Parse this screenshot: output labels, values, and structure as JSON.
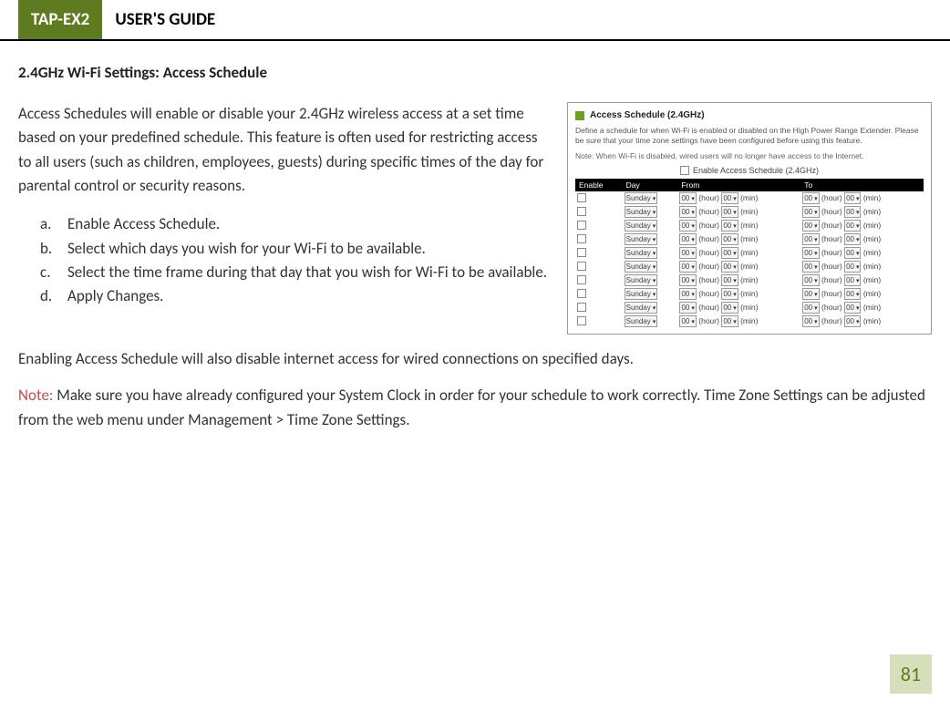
{
  "header": {
    "badge": "TAP-EX2",
    "title": "USER'S GUIDE"
  },
  "section_heading": "2.4GHz Wi-Fi Settings: Access Schedule",
  "intro": "Access Schedules will enable or disable your 2.4GHz wireless access at a set time based on your predefined schedule.  This feature is often used for restricting access to all users (such as children, employees, guests) during specific times of the day for parental control or security reasons.",
  "steps": [
    {
      "marker": "a.",
      "text": "Enable Access Schedule."
    },
    {
      "marker": "b.",
      "text": "Select which days you wish for your Wi-Fi to be available."
    },
    {
      "marker": "c.",
      "text": "Select the time frame during that day that you wish for Wi-Fi to be available."
    },
    {
      "marker": "d.",
      "text": "Apply Changes."
    }
  ],
  "post_para": "Enabling Access Schedule will also disable internet access for wired connections on specified days.",
  "note_label": "Note:",
  "note_text": "  Make sure you have already configured your System Clock in order for your schedule to work correctly.  Time Zone Settings can be adjusted from the web menu under Management > Time Zone Settings.",
  "page_number": "81",
  "shot": {
    "title": "Access Schedule (2.4GHz)",
    "desc": "Define a schedule for when Wi-Fi is enabled or disabled on the High Power Range Extender. Please be sure that your time zone settings have been configured before using this feature.",
    "note": "Note: When Wi-Fi is disabled, wired users will no longer have access to the Internet.",
    "enable_label": "Enable Access Schedule (2.4GHz)",
    "columns": {
      "enable": "Enable",
      "day": "Day",
      "from": "From",
      "to": "To"
    },
    "row_defaults": {
      "day": "Sunday",
      "hour": "00",
      "min": "00",
      "hour_label": "(hour)",
      "min_label": "(min)"
    },
    "row_count": 10
  }
}
